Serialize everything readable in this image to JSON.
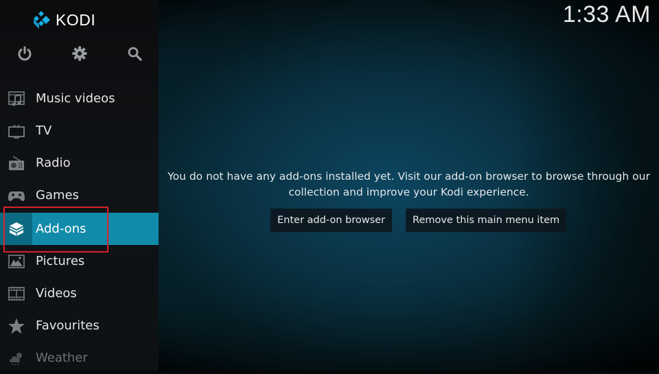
{
  "app": {
    "logo_text": "KODI",
    "clock": "1:33 AM"
  },
  "top_icons": [
    {
      "name": "power-icon",
      "label": "Power"
    },
    {
      "name": "gear-icon",
      "label": "Settings"
    },
    {
      "name": "search-icon",
      "label": "Search"
    }
  ],
  "sidebar": {
    "items": [
      {
        "label": "Music videos",
        "icon": "music-video-icon",
        "active": false
      },
      {
        "label": "TV",
        "icon": "tv-icon",
        "active": false
      },
      {
        "label": "Radio",
        "icon": "radio-icon",
        "active": false
      },
      {
        "label": "Games",
        "icon": "gamepad-icon",
        "active": false
      },
      {
        "label": "Add-ons",
        "icon": "addon-box-icon",
        "active": true
      },
      {
        "label": "Pictures",
        "icon": "picture-icon",
        "active": false
      },
      {
        "label": "Videos",
        "icon": "film-icon",
        "active": false
      },
      {
        "label": "Favourites",
        "icon": "star-icon",
        "active": false
      },
      {
        "label": "Weather",
        "icon": "weather-icon",
        "active": false
      }
    ]
  },
  "main": {
    "message_line1": "You do not have any add-ons installed yet. Visit our add-on browser to browse through our",
    "message_line2": "collection and improve your Kodi experience.",
    "buttons": [
      {
        "label": "Enter add-on browser"
      },
      {
        "label": "Remove this main menu item"
      }
    ]
  },
  "colors": {
    "accent": "#128baa",
    "accent_dark": "#0b6a82",
    "highlight_border": "#d8212c",
    "logo_blue": "#17b2e8"
  }
}
